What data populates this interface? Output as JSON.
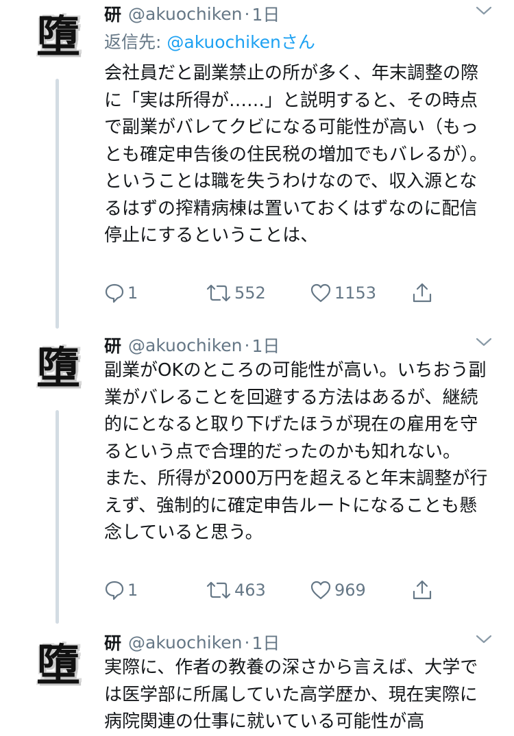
{
  "tweets": [
    {
      "avatar_glyph": "墮",
      "name": "研",
      "handle": "@akuochiken",
      "separator": "·",
      "time": "1日",
      "reply_prefix": "返信先: ",
      "reply_mention": "@akuochiken",
      "reply_suffix": "さん",
      "paragraphs": [
        "会社員だと副業禁止の所が多く、年末調整の際に「実は所得が……」と説明すると、その時点で副業がバレてクビになる可能性が高い（もっとも確定申告後の住民税の増加でもバレるが）。",
        "ということは職を失うわけなので、収入源となるはずの搾精病棟は置いておくはずなのに配信停止にするということは、"
      ],
      "replies": "1",
      "retweets": "552",
      "likes": "1153"
    },
    {
      "avatar_glyph": "墮",
      "name": "研",
      "handle": "@akuochiken",
      "separator": "·",
      "time": "1日",
      "paragraphs": [
        "副業がOKのところの可能性が高い。いちおう副業がバレることを回避する方法はあるが、継続的にとなると取り下げたほうが現在の雇用を守るという点で合理的だったのかも知れない。",
        "また、所得が2000万円を超えると年末調整が行えず、強制的に確定申告ルートになることも懸念していると思う。"
      ],
      "replies": "1",
      "retweets": "463",
      "likes": "969"
    },
    {
      "avatar_glyph": "墮",
      "name": "研",
      "handle": "@akuochiken",
      "separator": "·",
      "time": "1日",
      "paragraphs": [
        "実際に、作者の教養の深さから言えば、大学では医学部に所属していた高学歴か、現在実際に病院関連の仕事に就いている可能性が高"
      ]
    }
  ]
}
